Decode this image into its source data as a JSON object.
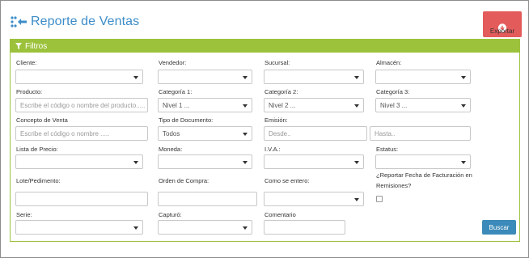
{
  "header": {
    "title": "Reporte de Ventas",
    "export_label": "Exportar"
  },
  "filters": {
    "title": "Filtros",
    "cliente": {
      "label": "Cliente:"
    },
    "vendedor": {
      "label": "Vendedor:"
    },
    "sucursal": {
      "label": "Sucursal:"
    },
    "almacen": {
      "label": "Almacén:"
    },
    "producto": {
      "label": "Producto:",
      "placeholder": "Escribe el código o nombre del producto....."
    },
    "categoria1": {
      "label": "Categoría 1:",
      "value": "Nivel 1 ..."
    },
    "categoria2": {
      "label": "Categoría 2:",
      "value": "Nivel 2 ..."
    },
    "categoria3": {
      "label": "Categoría 3:",
      "value": "Nivel 3 ..."
    },
    "concepto": {
      "label": "Concepto de Venta",
      "placeholder": "Escribe el código o nombre ....."
    },
    "tipo_documento": {
      "label": "Tipo de Documento:",
      "value": "Todos"
    },
    "emision": {
      "label": "Emisión:",
      "desde_placeholder": "Desde..",
      "hasta_placeholder": "Hasta.."
    },
    "lista_precio": {
      "label": "Lista de Precio:"
    },
    "moneda": {
      "label": "Moneda:"
    },
    "iva": {
      "label": "I.V.A.:"
    },
    "estatus": {
      "label": "Estatus:"
    },
    "lote": {
      "label": "Lote/Pedimento:"
    },
    "orden_compra": {
      "label": "Orden de Compra:"
    },
    "como_entero": {
      "label": "Como se entero:"
    },
    "reportar_fecha": {
      "label_line1": "¿Reportar Fecha de Facturación en",
      "label_line2": "Remisiones?"
    },
    "serie": {
      "label": "Serie:"
    },
    "capturo": {
      "label": "Capturó:"
    },
    "comentario": {
      "label": "Comentario"
    },
    "search_label": "Buscar"
  },
  "colors": {
    "title_blue": "#3d8dc9",
    "panel_green": "#9cc23c",
    "export_red": "#e45b5b",
    "search_blue": "#3b8ab9"
  },
  "icons": {
    "logo": "arrows-icon",
    "export": "cloud-download-icon",
    "filter": "funnel-icon"
  }
}
